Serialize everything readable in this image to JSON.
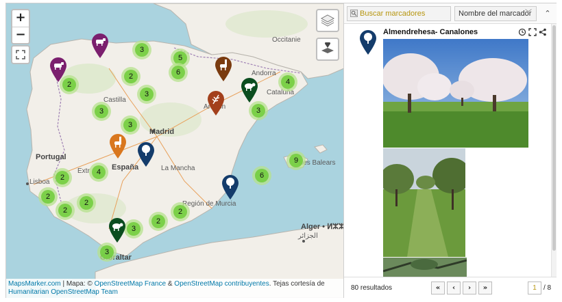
{
  "map": {
    "zoom_in": "+",
    "zoom_out": "−",
    "labels": {
      "madrid": "Madrid",
      "espana": "España",
      "portugal": "Portugal",
      "lisboa": "Lisboa",
      "andorra": "Andorra",
      "castilla": "Castilla",
      "la_mancha": "La Mancha",
      "aragon": "Aragón",
      "extremadura": "Extr",
      "gibraltar": "Gibraltar",
      "alger": "Alger • ⵍⵣⵣ",
      "alger_ar": "الجزائر",
      "occitanie": "Occitanie",
      "region_murcia": "Región de Murcia",
      "cataluna": "Cataluña",
      "baleares": "Illes Balears"
    },
    "clusters": [
      "3",
      "5",
      "6",
      "2",
      "2",
      "3",
      "3",
      "3",
      "4",
      "3",
      "9",
      "6",
      "4",
      "2",
      "2",
      "2",
      "2",
      "2",
      "2",
      "3",
      "3"
    ],
    "attribution": {
      "site": "MapsMarker.com",
      "sep1": " | Mapa: © ",
      "osm_fr": "OpenStreetMap France",
      "amp": " & ",
      "osm_contrib": "OpenStreetMap contribuyentes",
      "tiles": ". Tejas cortesía de ",
      "hot": "Humanitarian OpenStreetMap Team"
    },
    "colors": {
      "sea": "#aad3df",
      "land": "#f2efe9",
      "cluster_outer": "#b5e28c",
      "cluster_inner": "#6ecc39"
    },
    "pins": [
      {
        "icon": "cow-icon",
        "color": "#7b1f6e"
      },
      {
        "icon": "cow-icon",
        "color": "#7b1f6e"
      },
      {
        "icon": "llama-icon",
        "color": "#7a3b0f"
      },
      {
        "icon": "sheep-icon",
        "color": "#0b4d1f"
      },
      {
        "icon": "wheat-icon",
        "color": "#a3401c"
      },
      {
        "icon": "llama-icon",
        "color": "#d9771e"
      },
      {
        "icon": "tree-icon",
        "color": "#143c6b"
      },
      {
        "icon": "tree-icon",
        "color": "#143c6b"
      },
      {
        "icon": "sheep-icon",
        "color": "#0b4d1f"
      }
    ]
  },
  "panel": {
    "search_placeholder": "Buscar marcadores",
    "sort_label": "Nombre del marcador",
    "collapse": "⌃",
    "item": {
      "title": "Almendrehesa- Canalones",
      "icon": "tree-icon",
      "pin_color": "#143c6b"
    },
    "results": "80 resultados",
    "pager": {
      "first": "«",
      "prev": "‹",
      "next": "›",
      "last": "»"
    },
    "page": "1",
    "total": "/ 8"
  }
}
